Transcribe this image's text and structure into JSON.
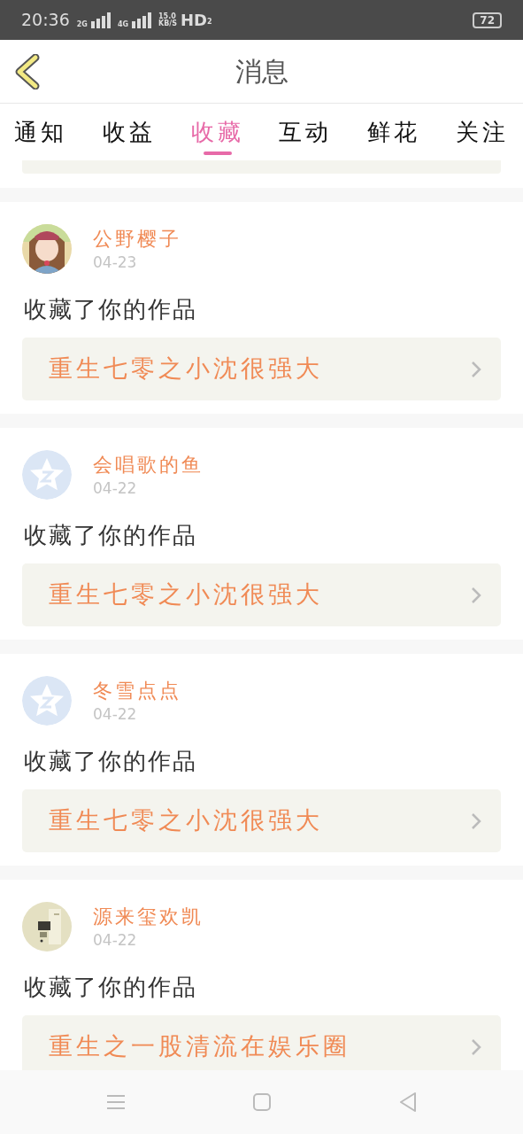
{
  "status_bar": {
    "time": "20:36",
    "network_1": "2G",
    "network_2": "4G",
    "speed": "15.0",
    "speed_unit": "KB/S",
    "hd": "HD",
    "hd_sim": "2",
    "battery": "72"
  },
  "header": {
    "title": "消息"
  },
  "tabs": [
    {
      "label": "通知",
      "selected": false
    },
    {
      "label": "收益",
      "selected": false
    },
    {
      "label": "收藏",
      "selected": true
    },
    {
      "label": "互动",
      "selected": false
    },
    {
      "label": "鲜花",
      "selected": false
    },
    {
      "label": "关注",
      "selected": false
    }
  ],
  "messages": [
    {
      "user": "公野樱子",
      "date": "04-23",
      "action": "收藏了你的作品",
      "work": "重生七零之小沈很强大"
    },
    {
      "avatar": {
        "kind": "default"
      },
      "user": "会唱歌的鱼",
      "date": "04-22",
      "action": "收藏了你的作品",
      "work": "重生七零之小沈很强大"
    },
    {
      "avatar": {
        "kind": "default"
      },
      "user": "冬雪点点",
      "date": "04-22",
      "action": "收藏了你的作品",
      "work": "重生七零之小沈很强大"
    },
    {
      "user": "源来玺欢凯",
      "date": "04-22",
      "action": "收藏了你的作品",
      "work": "重生之一股清流在娱乐圈"
    }
  ]
}
